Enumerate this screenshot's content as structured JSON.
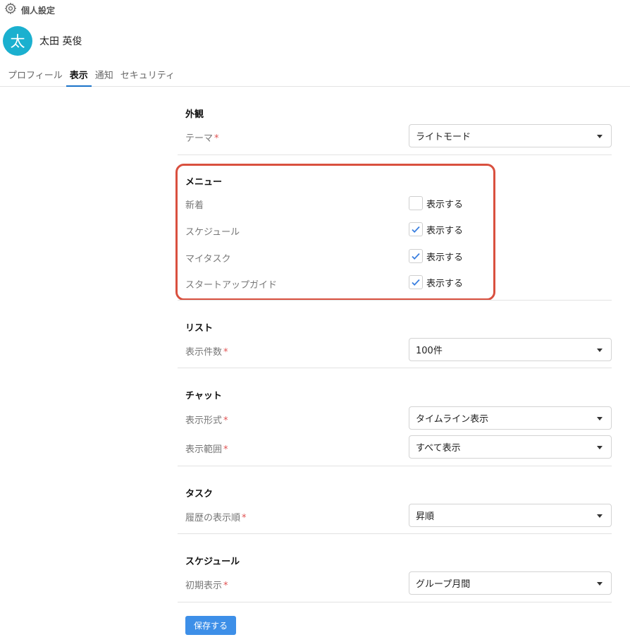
{
  "header": {
    "title": "個人設定",
    "icon": "gear-icon"
  },
  "user": {
    "avatar_char": "太",
    "name": "太田 英俊",
    "avatar_color": "#1bb0cf"
  },
  "tabs": [
    {
      "label": "プロフィール",
      "active": false
    },
    {
      "label": "表示",
      "active": true
    },
    {
      "label": "通知",
      "active": false
    },
    {
      "label": "セキュリティ",
      "active": false
    }
  ],
  "appearance": {
    "title": "外観",
    "theme_label": "テーマ",
    "theme_value": "ライトモード"
  },
  "menu": {
    "title": "メニュー",
    "items": [
      {
        "label": "新着",
        "check_label": "表示する",
        "checked": false
      },
      {
        "label": "スケジュール",
        "check_label": "表示する",
        "checked": true
      },
      {
        "label": "マイタスク",
        "check_label": "表示する",
        "checked": true
      },
      {
        "label": "スタートアップガイド",
        "check_label": "表示する",
        "checked": true
      }
    ]
  },
  "list": {
    "title": "リスト",
    "count_label": "表示件数",
    "count_value": "100件"
  },
  "chat": {
    "title": "チャット",
    "format_label": "表示形式",
    "format_value": "タイムライン表示",
    "range_label": "表示範囲",
    "range_value": "すべて表示"
  },
  "task": {
    "title": "タスク",
    "order_label": "履歴の表示順",
    "order_value": "昇順"
  },
  "schedule": {
    "title": "スケジュール",
    "initial_label": "初期表示",
    "initial_value": "グループ月間"
  },
  "required_mark": "*",
  "save_label": "保存する",
  "colors": {
    "accent": "#3d8fe8",
    "highlight": "#d9503f",
    "tab_underline": "#1a73c9"
  }
}
